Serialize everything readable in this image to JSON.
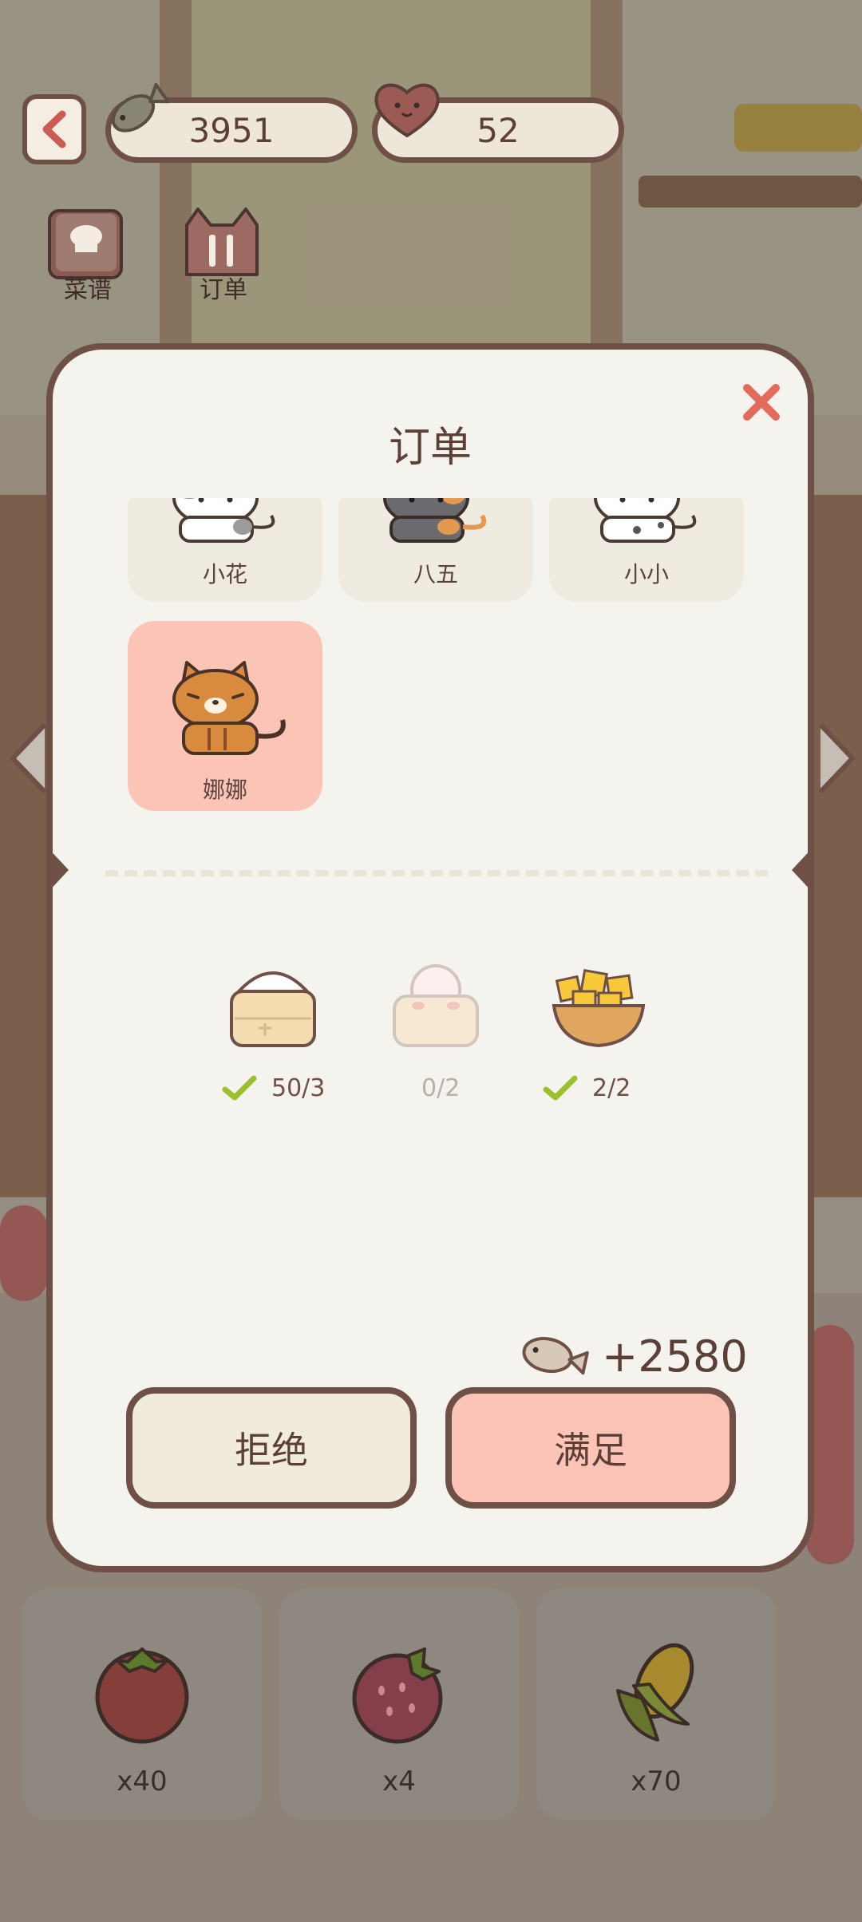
{
  "header": {
    "fish_currency": "3951",
    "heart_currency": "52"
  },
  "top_buttons": {
    "recipes_label": "菜谱",
    "orders_label": "订单"
  },
  "modal": {
    "title": "订单",
    "cats": [
      {
        "name": "小花",
        "selected": false
      },
      {
        "name": "八五",
        "selected": false
      },
      {
        "name": "小小",
        "selected": false
      },
      {
        "name": "娜娜",
        "selected": true
      }
    ],
    "requirements": [
      {
        "item": "steamed-bun",
        "count": "50/3",
        "complete": true
      },
      {
        "item": "dumpling",
        "count": "0/2",
        "complete": false
      },
      {
        "item": "fried-tofu",
        "count": "2/2",
        "complete": true
      }
    ],
    "reward": "+2580",
    "reject_label": "拒绝",
    "accept_label": "满足"
  },
  "ingredients": [
    {
      "item": "tomato",
      "count": "x40"
    },
    {
      "item": "strawberry",
      "count": "x4"
    },
    {
      "item": "corn",
      "count": "x70"
    }
  ],
  "colors": {
    "border": "#6e5046",
    "accent": "#fcc4b6",
    "check": "#9cbf2e",
    "close": "#e26b5c"
  }
}
